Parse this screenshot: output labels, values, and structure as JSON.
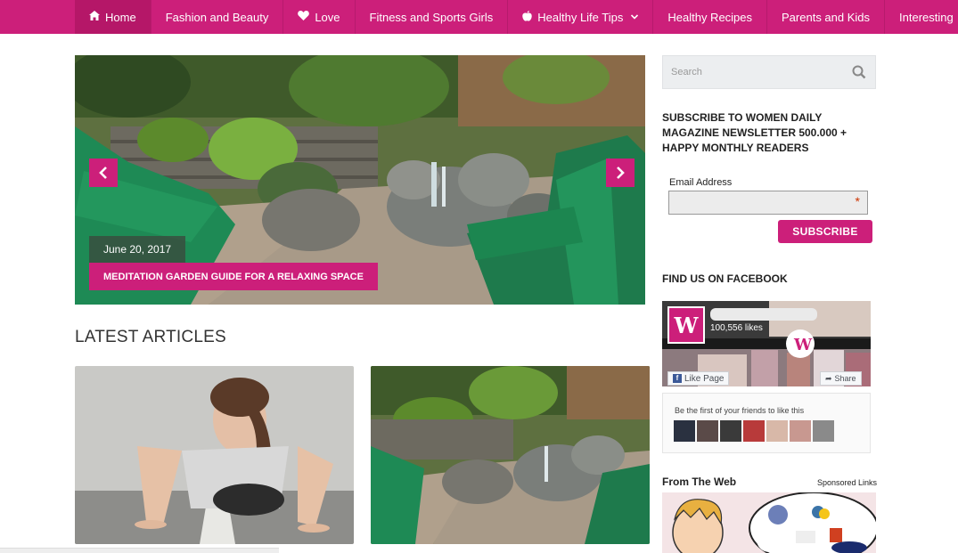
{
  "nav": {
    "items": [
      {
        "label": "Home",
        "icon": "home-icon"
      },
      {
        "label": "Fashion and Beauty"
      },
      {
        "label": "Love",
        "icon": "heart-icon"
      },
      {
        "label": "Fitness and Sports Girls"
      },
      {
        "label": "Healthy Life Tips",
        "icon": "apple-icon",
        "dropdown": true
      },
      {
        "label": "Healthy Recipes"
      },
      {
        "label": "Parents and Kids"
      },
      {
        "label": "Interesting",
        "dropdown": true
      }
    ]
  },
  "slider": {
    "date": "June 20, 2017",
    "title": "MEDITATION GARDEN GUIDE FOR A RELAXING SPACE",
    "prev_arrow": "‹",
    "next_arrow": "›"
  },
  "latest": {
    "heading": "LATEST ARTICLES"
  },
  "sidebar": {
    "search_placeholder": "Search",
    "subscribe_heading": "SUBSCRIBE TO WOMEN DAILY MAGAZINE NEWSLETTER 500.000 + HAPPY MONTHLY READERS",
    "email_label": "Email Address",
    "email_required": "*",
    "subscribe_button": "SUBSCRIBE",
    "facebook_heading": "FIND US ON FACEBOOK",
    "fb_logo_letter": "W",
    "fb_likes": "100,556 likes",
    "fb_like_button": "Like Page",
    "fb_share_button": "Share",
    "fb_friends_text": "Be the first of your friends to like this",
    "web_heading": "From The Web",
    "sponsored": "Sponsored Links"
  },
  "colors": {
    "brand": "#cc1f7a"
  }
}
